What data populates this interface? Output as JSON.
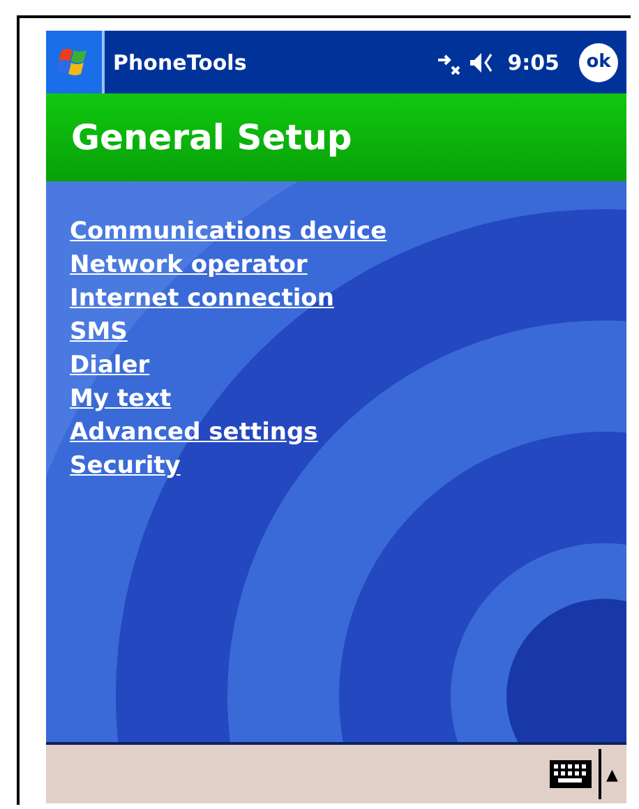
{
  "title_bar": {
    "app_name": "PhoneTools",
    "time": "9:05",
    "ok_button": "ok"
  },
  "header": {
    "title": "General Setup"
  },
  "links": [
    {
      "label": "Communications device"
    },
    {
      "label": "Network operator"
    },
    {
      "label": "Internet connection"
    },
    {
      "label": "SMS"
    },
    {
      "label": "Dialer"
    },
    {
      "label": "My text"
    },
    {
      "label": "Advanced settings"
    },
    {
      "label": "Security"
    }
  ],
  "menu_bar": {
    "input_arrow": "▲"
  }
}
